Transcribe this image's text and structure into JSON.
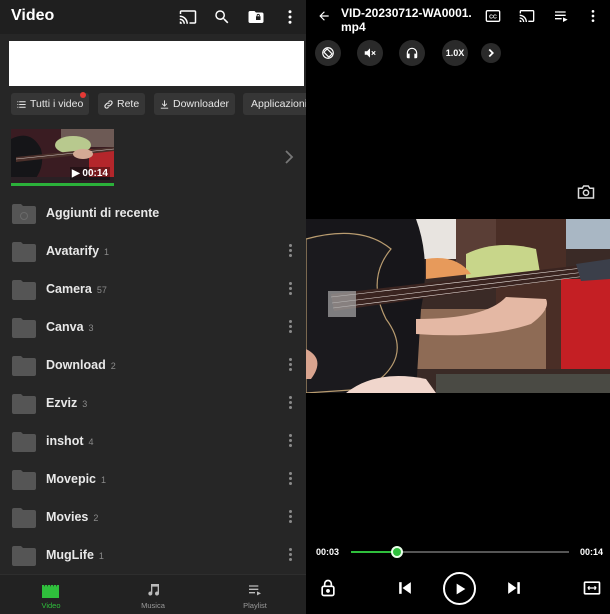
{
  "left": {
    "title": "Video",
    "top_icons": [
      "cast-icon",
      "search-icon",
      "private-folder-icon",
      "more-vertical-icon"
    ],
    "chips": [
      {
        "label": "Tutti i video",
        "icon": "list-icon",
        "notification": true
      },
      {
        "label": "Rete",
        "icon": "link-icon",
        "notification": false
      },
      {
        "label": "Downloader",
        "icon": "download-icon",
        "notification": false
      },
      {
        "label": "Applicazioni",
        "icon": "app-folder-icon",
        "notification": false
      }
    ],
    "recent_video": {
      "duration": "00:14",
      "progress": 1.0
    },
    "recent_folder": "Aggiunti di recente",
    "folders": [
      {
        "name": "Avatarify",
        "count": "1"
      },
      {
        "name": "Camera",
        "count": "57"
      },
      {
        "name": "Canva",
        "count": "3"
      },
      {
        "name": "Download",
        "count": "2"
      },
      {
        "name": "Ezviz",
        "count": "3"
      },
      {
        "name": "inshot",
        "count": "4"
      },
      {
        "name": "Movepic",
        "count": "1"
      },
      {
        "name": "Movies",
        "count": "2"
      },
      {
        "name": "MugLife",
        "count": "1"
      }
    ],
    "nav": [
      {
        "label": "Video",
        "active": true
      },
      {
        "label": "Musica",
        "active": false
      },
      {
        "label": "Playlist",
        "active": false
      }
    ]
  },
  "player": {
    "title": "VID-20230712-WA0001.mp4",
    "speed": "1.0X",
    "current_time": "00:03",
    "total_time": "00:14",
    "progress": 0.21,
    "accent": "#2fbf3c"
  }
}
